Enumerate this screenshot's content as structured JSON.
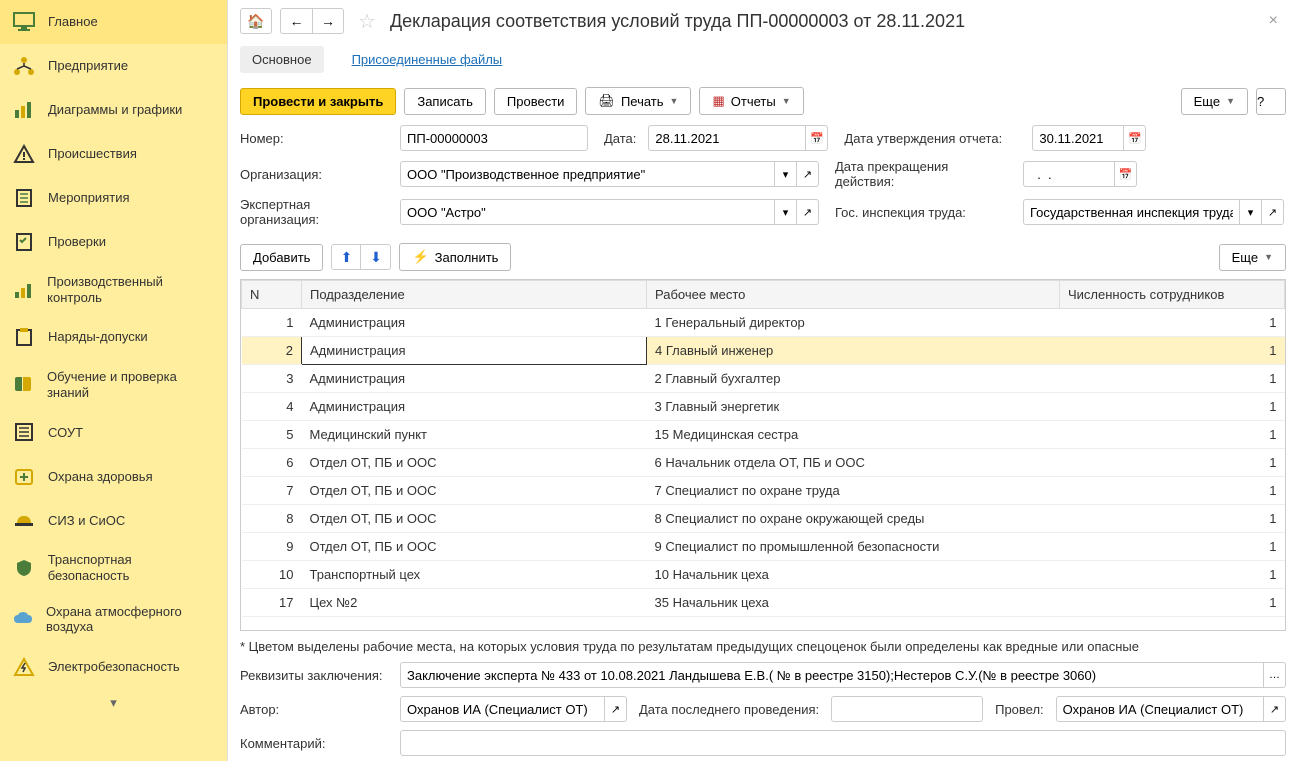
{
  "sidebar": {
    "items": [
      {
        "label": "Главное"
      },
      {
        "label": "Предприятие"
      },
      {
        "label": "Диаграммы и графики"
      },
      {
        "label": "Происшествия"
      },
      {
        "label": "Мероприятия"
      },
      {
        "label": "Проверки"
      },
      {
        "label": "Производственный контроль"
      },
      {
        "label": "Наряды-допуски"
      },
      {
        "label": "Обучение и проверка знаний"
      },
      {
        "label": "СОУТ"
      },
      {
        "label": "Охрана здоровья"
      },
      {
        "label": "СИЗ и СиОС"
      },
      {
        "label": "Транспортная безопасность"
      },
      {
        "label": "Охрана атмосферного воздуха"
      },
      {
        "label": "Электробезопасность"
      }
    ]
  },
  "header": {
    "title": "Декларация соответствия условий труда ПП-00000003 от 28.11.2021"
  },
  "tabs": {
    "main": "Основное",
    "files": "Присоединенные файлы"
  },
  "actions": {
    "post_close": "Провести и закрыть",
    "write": "Записать",
    "post": "Провести",
    "print": "Печать",
    "reports": "Отчеты",
    "more": "Еще",
    "help": "?"
  },
  "fields": {
    "number_label": "Номер:",
    "number_value": "ПП-00000003",
    "date_label": "Дата:",
    "date_value": "28.11.2021",
    "approve_label": "Дата утверждения отчета:",
    "approve_value": "30.11.2021",
    "org_label": "Организация:",
    "org_value": "ООО \"Производственное предприятие\"",
    "stop_label": "Дата прекращения действия:",
    "stop_value": "  .  .    ",
    "expert_label": "Экспертная организация:",
    "expert_value": "ООО \"Астро\"",
    "git_label": "Гос. инспекция труда:",
    "git_value": "Государственная инспекция труда в"
  },
  "table_actions": {
    "add": "Добавить",
    "fill": "Заполнить",
    "more": "Еще"
  },
  "table": {
    "headers": {
      "n": "N",
      "dept": "Подразделение",
      "place": "Рабочее место",
      "count": "Численность сотрудников"
    },
    "rows": [
      {
        "n": "1",
        "dept": "Администрация",
        "pnum": "1",
        "place": "Генеральный директор",
        "count": "1"
      },
      {
        "n": "2",
        "dept": "Администрация",
        "pnum": "4",
        "place": "Главный инженер",
        "count": "1"
      },
      {
        "n": "3",
        "dept": "Администрация",
        "pnum": "2",
        "place": "Главный бухгалтер",
        "count": "1"
      },
      {
        "n": "4",
        "dept": "Администрация",
        "pnum": "3",
        "place": "Главный энергетик",
        "count": "1"
      },
      {
        "n": "5",
        "dept": "Медицинский пункт",
        "pnum": "15",
        "place": "Медицинская сестра",
        "count": "1"
      },
      {
        "n": "6",
        "dept": "Отдел ОТ, ПБ и ООС",
        "pnum": "6",
        "place": "Начальник отдела ОТ, ПБ и ООС",
        "count": "1"
      },
      {
        "n": "7",
        "dept": "Отдел ОТ, ПБ и ООС",
        "pnum": "7",
        "place": "Специалист по охране труда",
        "count": "1"
      },
      {
        "n": "8",
        "dept": "Отдел ОТ, ПБ и ООС",
        "pnum": "8",
        "place": "Специалист по охране окружающей среды",
        "count": "1"
      },
      {
        "n": "9",
        "dept": "Отдел ОТ, ПБ и ООС",
        "pnum": "9",
        "place": "Специалист по промышленной безопасности",
        "count": "1"
      },
      {
        "n": "10",
        "dept": "Транспортный цех",
        "pnum": "10",
        "place": "Начальник цеха",
        "count": "1"
      },
      {
        "n": "17",
        "dept": "Цех №2",
        "pnum": "35",
        "place": "Начальник цеха",
        "count": "1"
      }
    ]
  },
  "footnote": "* Цветом выделены рабочие места, на которых условия труда по результатам предыдущих спецоценок были определены как вредные или опасные",
  "bottom": {
    "req_label": "Реквизиты заключения:",
    "req_value": "Заключение эксперта № 433 от 10.08.2021 Ландышева Е.В.( № в реестре 3150);Нестеров С.У.(№ в реестре 3060)",
    "author_label": "Автор:",
    "author_value": "Охранов ИА (Специалист ОТ)",
    "lastdate_label": "Дата последнего проведения:",
    "lastdate_value": "",
    "conducted_label": "Провел:",
    "conducted_value": "Охранов ИА (Специалист ОТ)",
    "comment_label": "Комментарий:",
    "comment_value": ""
  }
}
